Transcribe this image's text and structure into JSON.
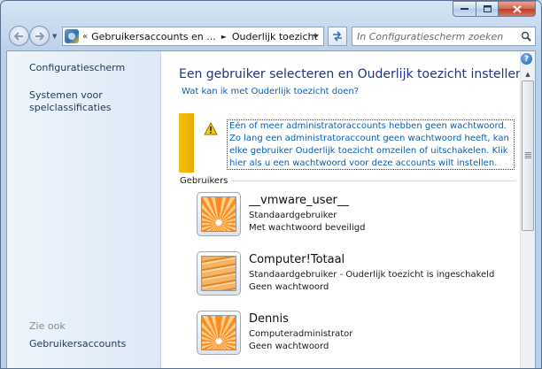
{
  "window": {
    "controls": {
      "minimize_icon": "minimize-icon",
      "maximize_icon": "maximize-icon",
      "close_icon": "close-icon"
    }
  },
  "toolbar": {
    "breadcrumb": {
      "prefix": "«",
      "items": [
        "Gebruikersaccounts en ...",
        "Ouderlijk toezicht"
      ],
      "separator": "►"
    },
    "search_placeholder": "In Configuratiescherm zoeken"
  },
  "sidebar": {
    "links": [
      "Configuratiescherm",
      "Systemen voor spelclassificaties"
    ],
    "see_also_heading": "Zie ook",
    "see_also_links": [
      "Gebruikersaccounts"
    ]
  },
  "main": {
    "title": "Een gebruiker selecteren en Ouderlijk toezicht instellen",
    "help_link": "Wat kan ik met Ouderlijk toezicht doen?",
    "warning": {
      "text": "Eén of meer administratoraccounts hebben geen wachtwoord. Zo lang een administratoraccount geen wachtwoord heeft, kan elke gebruiker Ouderlijk toezicht omzeilen of uitschakelen. Klik hier als u een wachtwoord voor deze accounts wilt instellen.",
      "icon": "warning-icon",
      "accent_color": "#f4c20d"
    },
    "users_heading": "Gebruikers",
    "users": [
      {
        "name": "__vmware_user__",
        "type": "Standaardgebruiker",
        "status": "Met wachtwoord beveiligd",
        "picture": "flower"
      },
      {
        "name": "Computer!Totaal",
        "type": "Standaardgebruiker - Ouderlijk toezicht is ingeschakeld",
        "status": "Geen wachtwoord",
        "picture": "stairs"
      },
      {
        "name": "Dennis",
        "type": "Computeradministrator",
        "status": "Geen wachtwoord",
        "picture": "flower"
      }
    ]
  },
  "colors": {
    "title_blue": "#1e3287",
    "link_blue": "#0a5fb4"
  }
}
